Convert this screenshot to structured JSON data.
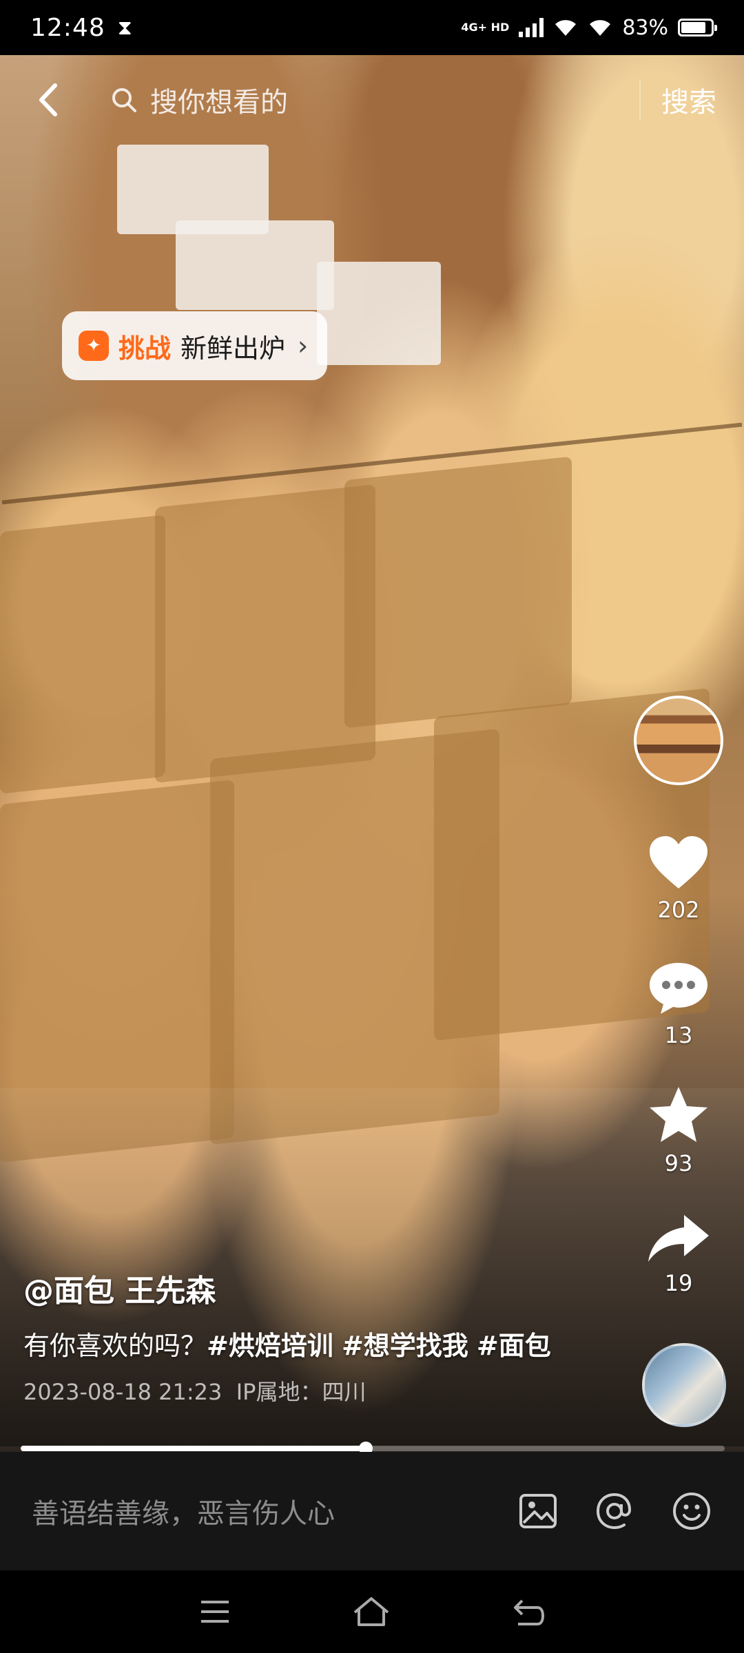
{
  "status_bar": {
    "time": "12:48",
    "network_top": "4G+ HD",
    "battery_pct": "83%",
    "battery_level": 0.83
  },
  "search": {
    "placeholder": "搜你想看的",
    "button": "搜索"
  },
  "challenge": {
    "tag": "挑战",
    "title": "新鲜出炉"
  },
  "actions": {
    "likes": "202",
    "comments": "13",
    "favorites": "93",
    "shares": "19"
  },
  "caption": {
    "author": "@面包 王先森",
    "text": "有你喜欢的吗？",
    "tags": [
      "#烘焙培训",
      "#想学找我",
      "#面包"
    ],
    "time": "2023-08-18 21:23",
    "ip_location": "IP属地：四川"
  },
  "progress": {
    "fraction": 0.49
  },
  "comment_bar": {
    "placeholder": "善语结善缘，恶言伤人心"
  },
  "colors": {
    "accent": "#ff6a1a",
    "comment_bg": "#161616"
  },
  "icons": [
    "back-arrow-icon",
    "search-icon",
    "heart-icon",
    "comment-icon",
    "star-icon",
    "share-icon",
    "image-icon",
    "at-icon",
    "emoji-icon",
    "menu-icon",
    "home-icon",
    "back-icon"
  ]
}
